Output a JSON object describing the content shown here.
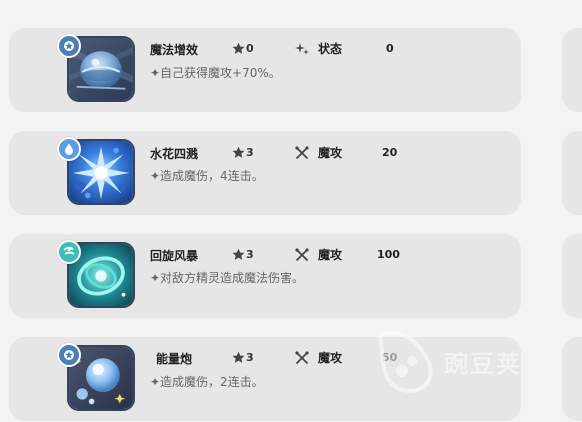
{
  "skills": [
    {
      "name": "魔法增效",
      "stars": "0",
      "category": "状态",
      "power": "0",
      "description": "✦自己获得魔攻+70%。",
      "icon": "magic-boost-icon",
      "badge_icon": "magic-type-icon",
      "badge_color": "#4a7fb8",
      "category_icon": "sparkle-icon"
    },
    {
      "name": "水花四溅",
      "stars": "3",
      "category": "魔攻",
      "power": "20",
      "description": "✦造成魔伤，4连击。",
      "icon": "water-splash-icon",
      "badge_icon": "water-type-icon",
      "badge_color": "#5b9be8",
      "category_icon": "crossed-wands-icon"
    },
    {
      "name": "回旋风暴",
      "stars": "3",
      "category": "魔攻",
      "power": "100",
      "description": "✦对敌方精灵造成魔法伤害。",
      "icon": "whirl-storm-icon",
      "badge_icon": "wind-type-icon",
      "badge_color": "#3bbfb6",
      "category_icon": "crossed-wands-icon"
    },
    {
      "name": "能量炮",
      "stars": "3",
      "category": "魔攻",
      "power": "50",
      "description": "✦造成魔伤，2连击。",
      "icon": "energy-cannon-icon",
      "badge_icon": "magic-type-icon",
      "badge_color": "#4a7fb8",
      "category_icon": "crossed-wands-icon"
    }
  ],
  "watermark": {
    "text": "豌豆荚",
    "icon": "pea-pod-logo-icon"
  }
}
